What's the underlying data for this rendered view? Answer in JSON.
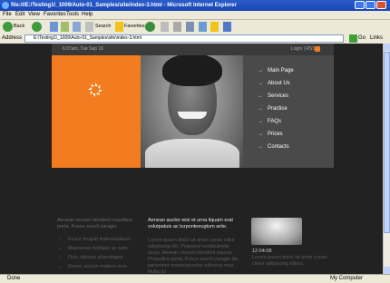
{
  "window": {
    "title": "file:///E:/Testing1/_1009/Auto-01_Samples/site/index-3.html - Microsoft Internet Explorer"
  },
  "menu": [
    "File",
    "Edit",
    "View",
    "Favorites",
    "Tools",
    "Help"
  ],
  "toolbar": {
    "back": "Back",
    "search": "Search",
    "favorites": "Favorites"
  },
  "address": {
    "label": "Address",
    "url": "E:\\Testing1\\_1009\\Auto-01_Samples\\site\\index-3.html",
    "go": "Go",
    "links": "Links"
  },
  "site": {
    "date": "6:37am, Tue Sep 16",
    "login": "Login | RSS",
    "nav": [
      "Main Page",
      "About Us",
      "Services",
      "Practice",
      "FAQs",
      "Prices",
      "Contacts"
    ],
    "col1": {
      "intro": "Aenean nonum hendent mauribus porta. Fusce suscil varagis.",
      "items": [
        "Fusce feugiat malesuadaum",
        "Maecenas tristique ac sem",
        "Duis ultricies pharetagna",
        "Donec accum malesa orce"
      ]
    },
    "col2": {
      "heading": "Aenean auctor wisi et urna liquam erat volutpatuis ac turponteeugtum ante.",
      "body": "Lorem ipsum dolor sit amet conse ctitur adipiscing elit. Praesent vestibulentie lacus. Aenean nonum hendent mauris. Phasellus porta. Fusce suscit varagis dis parturient montesaccutur ridiculus mus. Nulla du"
    },
    "col3": {
      "time": "12:04:08",
      "body": "Lorem ipsum dolor sit amet conse ctetur adipiscing elitars."
    }
  },
  "status": {
    "left": "Done",
    "zone": "My Computer"
  }
}
